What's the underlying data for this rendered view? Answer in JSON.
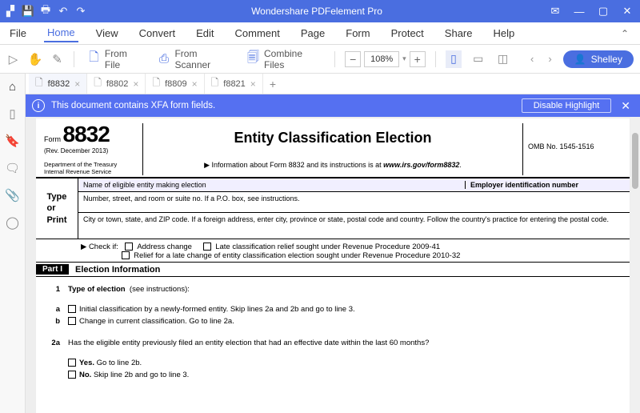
{
  "titlebar": {
    "title": "Wondershare PDFelement Pro"
  },
  "menubar": {
    "items": [
      "File",
      "Home",
      "View",
      "Convert",
      "Edit",
      "Comment",
      "Page",
      "Form",
      "Protect",
      "Share",
      "Help"
    ],
    "active": 1
  },
  "toolbar": {
    "from_file": "From File",
    "from_scanner": "From Scanner",
    "combine": "Combine Files",
    "zoom": "108%",
    "user": "Shelley"
  },
  "tabs": {
    "items": [
      "f8832",
      "f8802",
      "f8809",
      "f8821"
    ],
    "active": 0
  },
  "notice": {
    "text": "This document contains XFA form fields.",
    "button": "Disable Highlight"
  },
  "form": {
    "form_label": "Form",
    "form_number": "8832",
    "rev": "(Rev. December 2013)",
    "dept": "Department of the Treasury\nInternal Revenue Service",
    "title": "Entity Classification Election",
    "info_prefix": "▶ Information about Form 8832 and its instructions is at ",
    "info_url": "www.irs.gov/form8832",
    "omb": "OMB No. 1545-1516",
    "type_or_print": "Type\nor\nPrint",
    "row_name": "Name of eligible entity making election",
    "row_ein": "Employer identification number",
    "row_addr": "Number, street, and room or suite no. If a P.O. box, see instructions.",
    "row_city": "City or town, state, and ZIP code. If a foreign address, enter city, province or state, postal code and country. Follow the country's practice for entering the postal code.",
    "checkif_label": "▶ Check if:",
    "checkif_a": "Address change",
    "checkif_b": "Late classification relief sought under Revenue Procedure 2009-41",
    "checkif_c": "Relief for a late change of entity classification election sought under Revenue Procedure 2010-32",
    "part1_badge": "Part I",
    "part1_title": "Election Information",
    "q1_num": "1",
    "q1_label": "Type of election",
    "q1_suffix": "(see instructions):",
    "q1a_num": "a",
    "q1a": "Initial classification by a newly-formed entity. Skip lines 2a and 2b and go to line 3.",
    "q1b_num": "b",
    "q1b": "Change in current classification. Go to line 2a.",
    "q2a_num": "2a",
    "q2a": "Has the eligible entity previously filed an entity election that had an effective date within the last 60 months?",
    "q2a_yes": "Go to line 2b.",
    "q2a_no": "Skip line 2b and go to line 3.",
    "yes": "Yes.",
    "no": "No."
  }
}
